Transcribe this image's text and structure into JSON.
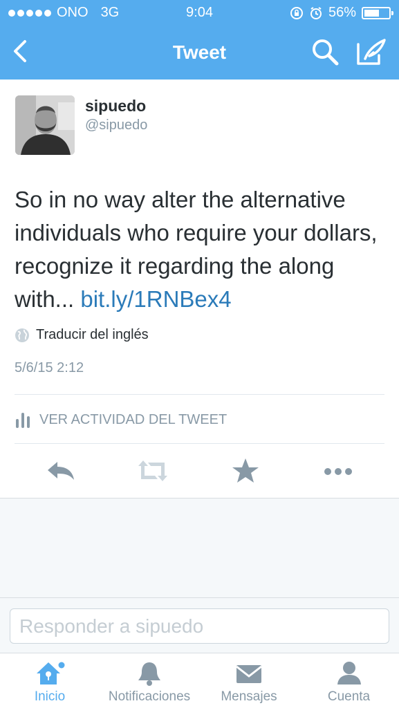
{
  "status_bar": {
    "carrier": "ONO",
    "network": "3G",
    "time": "9:04",
    "battery": "56%",
    "battery_level": 0.56
  },
  "nav": {
    "title": "Tweet",
    "back_icon": "chevron-left-icon",
    "search_icon": "search-icon",
    "compose_icon": "compose-icon"
  },
  "tweet": {
    "name": "sipuedo",
    "handle": "@sipuedo",
    "text": "So in no way alter the alternative individuals who require your dollars, recognize it regarding the along with... ",
    "link": "bit.ly/1RNBex4",
    "translate": "Traducir del inglés",
    "date": "5/6/15 2:12",
    "activity": "VER ACTIVIDAD DEL TWEET"
  },
  "reply": {
    "placeholder": "Responder a sipuedo"
  },
  "tabs": [
    {
      "label": "Inicio",
      "icon": "home-icon",
      "active": true
    },
    {
      "label": "Notificaciones",
      "icon": "bell-icon",
      "active": false
    },
    {
      "label": "Mensajes",
      "icon": "envelope-icon",
      "active": false
    },
    {
      "label": "Cuenta",
      "icon": "person-icon",
      "active": false
    }
  ],
  "colors": {
    "brand": "#55acee",
    "link": "#2b7bb9",
    "muted": "#8899a6",
    "text": "#292f33"
  }
}
